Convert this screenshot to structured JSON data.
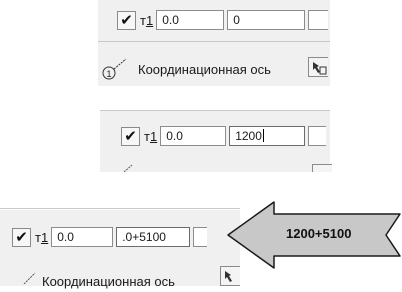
{
  "panel1": {
    "point_label": "т",
    "point_index": "1",
    "x_value": "0.0",
    "y_value": "0",
    "axis_label": "Координационная ось",
    "marker_number": "1"
  },
  "panel2": {
    "point_label": "т",
    "point_index": "1",
    "x_value": "0.0",
    "y_value": "1200"
  },
  "panel3": {
    "point_label": "т",
    "point_index": "1",
    "x_value": "0.0",
    "y_value": ".0+5100",
    "axis_label": "Координационная ось"
  },
  "callout": {
    "text": "1200+5100",
    "color": "#c8c8c8"
  },
  "icons": {
    "check": "checkmark-icon",
    "axis_tool": "line-tool-icon",
    "snap_tool": "snap-cursor-icon"
  }
}
